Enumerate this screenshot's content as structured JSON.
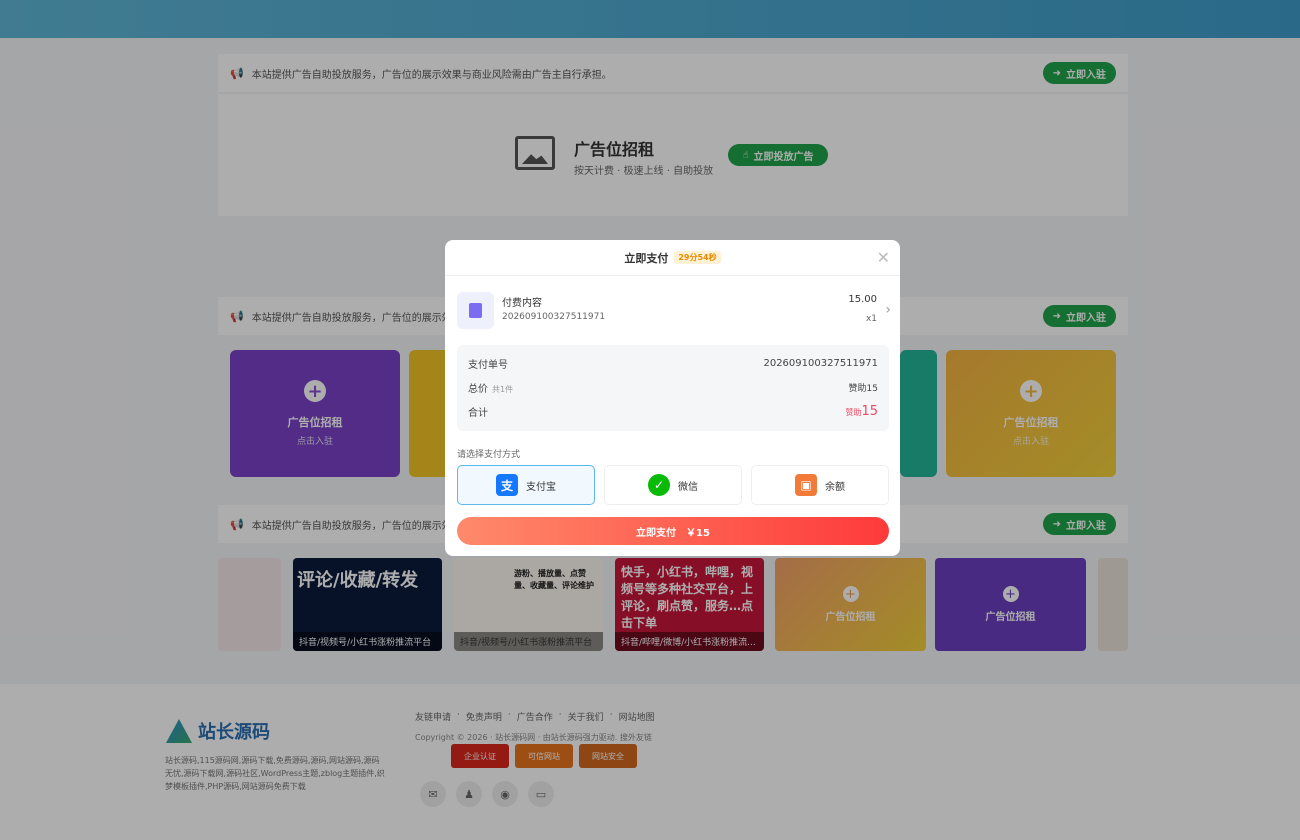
{
  "ad_notice": {
    "text": "本站提供广告自助投放服务，广告位的展示效果与商业风险需由广告主自行承担。",
    "text_short": "本站提供广告自助投放服务，广告位的展示效",
    "join_label": "立即入驻"
  },
  "ad_panel": {
    "title": "广告位招租",
    "subtitle": "按天计费 · 极速上线 · 自助投放",
    "button_label": "立即投放广告"
  },
  "ad_cards": [
    {
      "title": "广告位招租",
      "sub": "点击入驻",
      "color": "#7a42c8"
    },
    {
      "title": "广告位招租",
      "sub": "点击入驻",
      "color": "#f0c23a"
    }
  ],
  "thumbs": [
    {
      "caption": "抖音/视频号/小红书涨粉推流平台",
      "big": "评论/收藏/转发"
    },
    {
      "caption": "抖音/视频号/小红书涨粉推流平台",
      "big": "游粉、播放量、点赞量、收藏量、评论维护"
    },
    {
      "caption": "抖音/哔哩/微博/小红书涨粉推流...",
      "big": "快手，小红书，哔哩，视频号等多种社交平台，上评论，刷点赞，服务…点击下单"
    },
    {
      "title": "广告位招租"
    },
    {
      "title": "广告位招租"
    }
  ],
  "footer": {
    "logo_text": "站长源码",
    "desc": "站长源码,115源码网,源码下载,免费源码,源码,网站源码,源码无忧,源码下载网,源码社区,WordPress主题,zblog主题插件,织梦模板插件,PHP源码,网站源码免费下载",
    "links": [
      "友链申请",
      "·",
      "免责声明",
      "·",
      "广告合作",
      "·",
      "关于我们",
      "·",
      "网站地图"
    ],
    "copyright": "Copyright © 2026 · 站长源码网 · 由站长源码强力驱动. 搜外友链",
    "badges": [
      "企业认证",
      "可信网站",
      "网站安全"
    ]
  },
  "modal": {
    "title": "立即支付",
    "timer": "29分54秒",
    "item_name": "付费内容",
    "item_order": "202609100327511971",
    "item_price": "15.00",
    "item_qty": "x1",
    "order_label": "支付单号",
    "order_value": "202609100327511971",
    "total_label": "总价",
    "total_count": "共1件",
    "total_value": "赞助15",
    "sum_label": "合计",
    "sum_prefix": "赞助",
    "sum_value": "15",
    "method_label": "请选择支付方式",
    "methods": [
      "支付宝",
      "微信",
      "余额"
    ],
    "pay_label": "立即支付",
    "pay_amount": "￥15"
  },
  "colors": {
    "accent_green": "#1fa34a",
    "pay_gradient_start": "#ff8a6b",
    "pay_gradient_end": "#fe3a3a",
    "alipay": "#1677ff",
    "wechat": "#09bb07",
    "balance": "#f27b3a"
  }
}
